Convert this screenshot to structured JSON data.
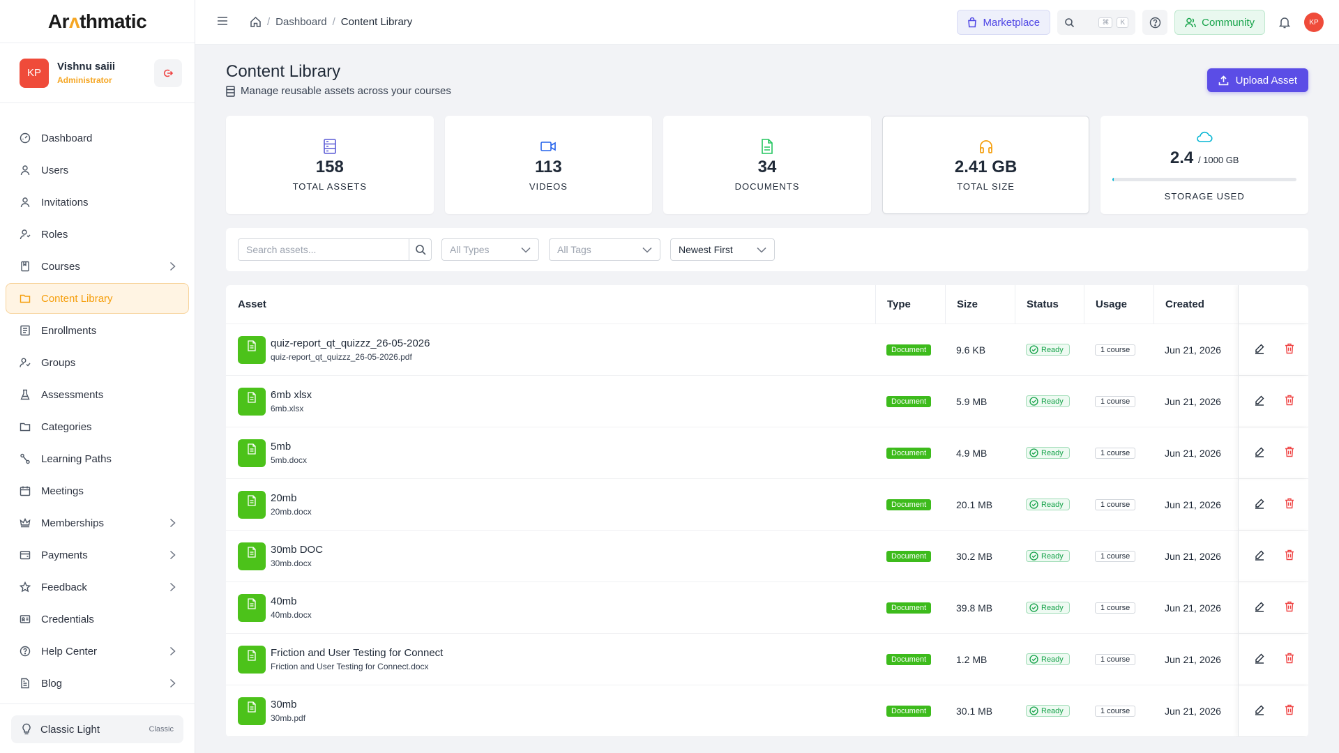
{
  "app": {
    "logo_pre": "Ar",
    "logo_mid": "ɅΛ",
    "logo_post": "thmatic",
    "logo_text": "Arithmatic"
  },
  "user": {
    "initials": "KP",
    "name": "Vishnu saiii",
    "role": "Administrator"
  },
  "sidebar": {
    "items": [
      {
        "label": "Dashboard",
        "icon": "dashboard-icon",
        "chevron": false
      },
      {
        "label": "Users",
        "icon": "user-icon",
        "chevron": false
      },
      {
        "label": "Invitations",
        "icon": "user-icon",
        "chevron": false
      },
      {
        "label": "Roles",
        "icon": "roles-icon",
        "chevron": false
      },
      {
        "label": "Courses",
        "icon": "book-icon",
        "chevron": true
      },
      {
        "label": "Content Library",
        "icon": "folder-icon",
        "chevron": false,
        "active": true
      },
      {
        "label": "Enrollments",
        "icon": "list-icon",
        "chevron": false
      },
      {
        "label": "Groups",
        "icon": "group-icon",
        "chevron": false
      },
      {
        "label": "Assessments",
        "icon": "flask-icon",
        "chevron": false
      },
      {
        "label": "Categories",
        "icon": "folder-icon",
        "chevron": false
      },
      {
        "label": "Learning Paths",
        "icon": "path-icon",
        "chevron": false
      },
      {
        "label": "Meetings",
        "icon": "calendar-icon",
        "chevron": false
      },
      {
        "label": "Memberships",
        "icon": "crown-icon",
        "chevron": true
      },
      {
        "label": "Payments",
        "icon": "wallet-icon",
        "chevron": true
      },
      {
        "label": "Feedback",
        "icon": "star-icon",
        "chevron": true
      },
      {
        "label": "Credentials",
        "icon": "id-card-icon",
        "chevron": false
      },
      {
        "label": "Help Center",
        "icon": "help-icon",
        "chevron": true
      },
      {
        "label": "Blog",
        "icon": "doc-icon",
        "chevron": true
      }
    ],
    "theme": {
      "label": "Classic Light",
      "badge": "Classic"
    }
  },
  "topbar": {
    "breadcrumb": {
      "parent": "Dashboard",
      "current": "Content Library"
    },
    "marketplace_label": "Marketplace",
    "kbd_cmd": "⌘",
    "kbd_k": "K",
    "community_label": "Community",
    "avatar_initials": "KP"
  },
  "page": {
    "title": "Content Library",
    "subtitle": "Manage reusable assets across your courses",
    "upload_label": "Upload Asset"
  },
  "stats": [
    {
      "value": "158",
      "label": "TOTAL ASSETS",
      "color": "#5b5bd6"
    },
    {
      "value": "113",
      "label": "VIDEOS",
      "color": "#2563eb"
    },
    {
      "value": "34",
      "label": "DOCUMENTS",
      "color": "#22c55e"
    },
    {
      "value": "2.41 GB",
      "label": "TOTAL SIZE",
      "color": "#f59e0b"
    },
    {
      "value": "2.4",
      "suffix": "/ 1000 GB",
      "label": "STORAGE USED",
      "color": "#06b6d4",
      "fraction": 0.0024
    }
  ],
  "filters": {
    "search_placeholder": "Search assets...",
    "type": "All Types",
    "tags": "All Tags",
    "sort": "Newest First"
  },
  "table": {
    "headers": {
      "asset": "Asset",
      "type": "Type",
      "size": "Size",
      "status": "Status",
      "usage": "Usage",
      "created": "Created"
    },
    "rows": [
      {
        "name": "quiz-report_qt_quizzz_26-05-2026",
        "file": "quiz-report_qt_quizzz_26-05-2026.pdf",
        "type": "Document",
        "size": "9.6 KB",
        "status": "Ready",
        "usage": "1 course",
        "created": "Jun 21, 2026"
      },
      {
        "name": "6mb xlsx",
        "file": "6mb.xlsx",
        "type": "Document",
        "size": "5.9 MB",
        "status": "Ready",
        "usage": "1 course",
        "created": "Jun 21, 2026"
      },
      {
        "name": "5mb",
        "file": "5mb.docx",
        "type": "Document",
        "size": "4.9 MB",
        "status": "Ready",
        "usage": "1 course",
        "created": "Jun 21, 2026"
      },
      {
        "name": "20mb",
        "file": "20mb.docx",
        "type": "Document",
        "size": "20.1 MB",
        "status": "Ready",
        "usage": "1 course",
        "created": "Jun 21, 2026"
      },
      {
        "name": "30mb DOC",
        "file": "30mb.docx",
        "type": "Document",
        "size": "30.2 MB",
        "status": "Ready",
        "usage": "1 course",
        "created": "Jun 21, 2026"
      },
      {
        "name": "40mb",
        "file": "40mb.docx",
        "type": "Document",
        "size": "39.8 MB",
        "status": "Ready",
        "usage": "1 course",
        "created": "Jun 21, 2026"
      },
      {
        "name": "Friction and User Testing for Connect",
        "file": "Friction and User Testing for Connect.docx",
        "type": "Document",
        "size": "1.2 MB",
        "status": "Ready",
        "usage": "1 course",
        "created": "Jun 21, 2026"
      },
      {
        "name": "30mb",
        "file": "30mb.pdf",
        "type": "Document",
        "size": "30.1 MB",
        "status": "Ready",
        "usage": "1 course",
        "created": "Jun 21, 2026"
      }
    ]
  }
}
